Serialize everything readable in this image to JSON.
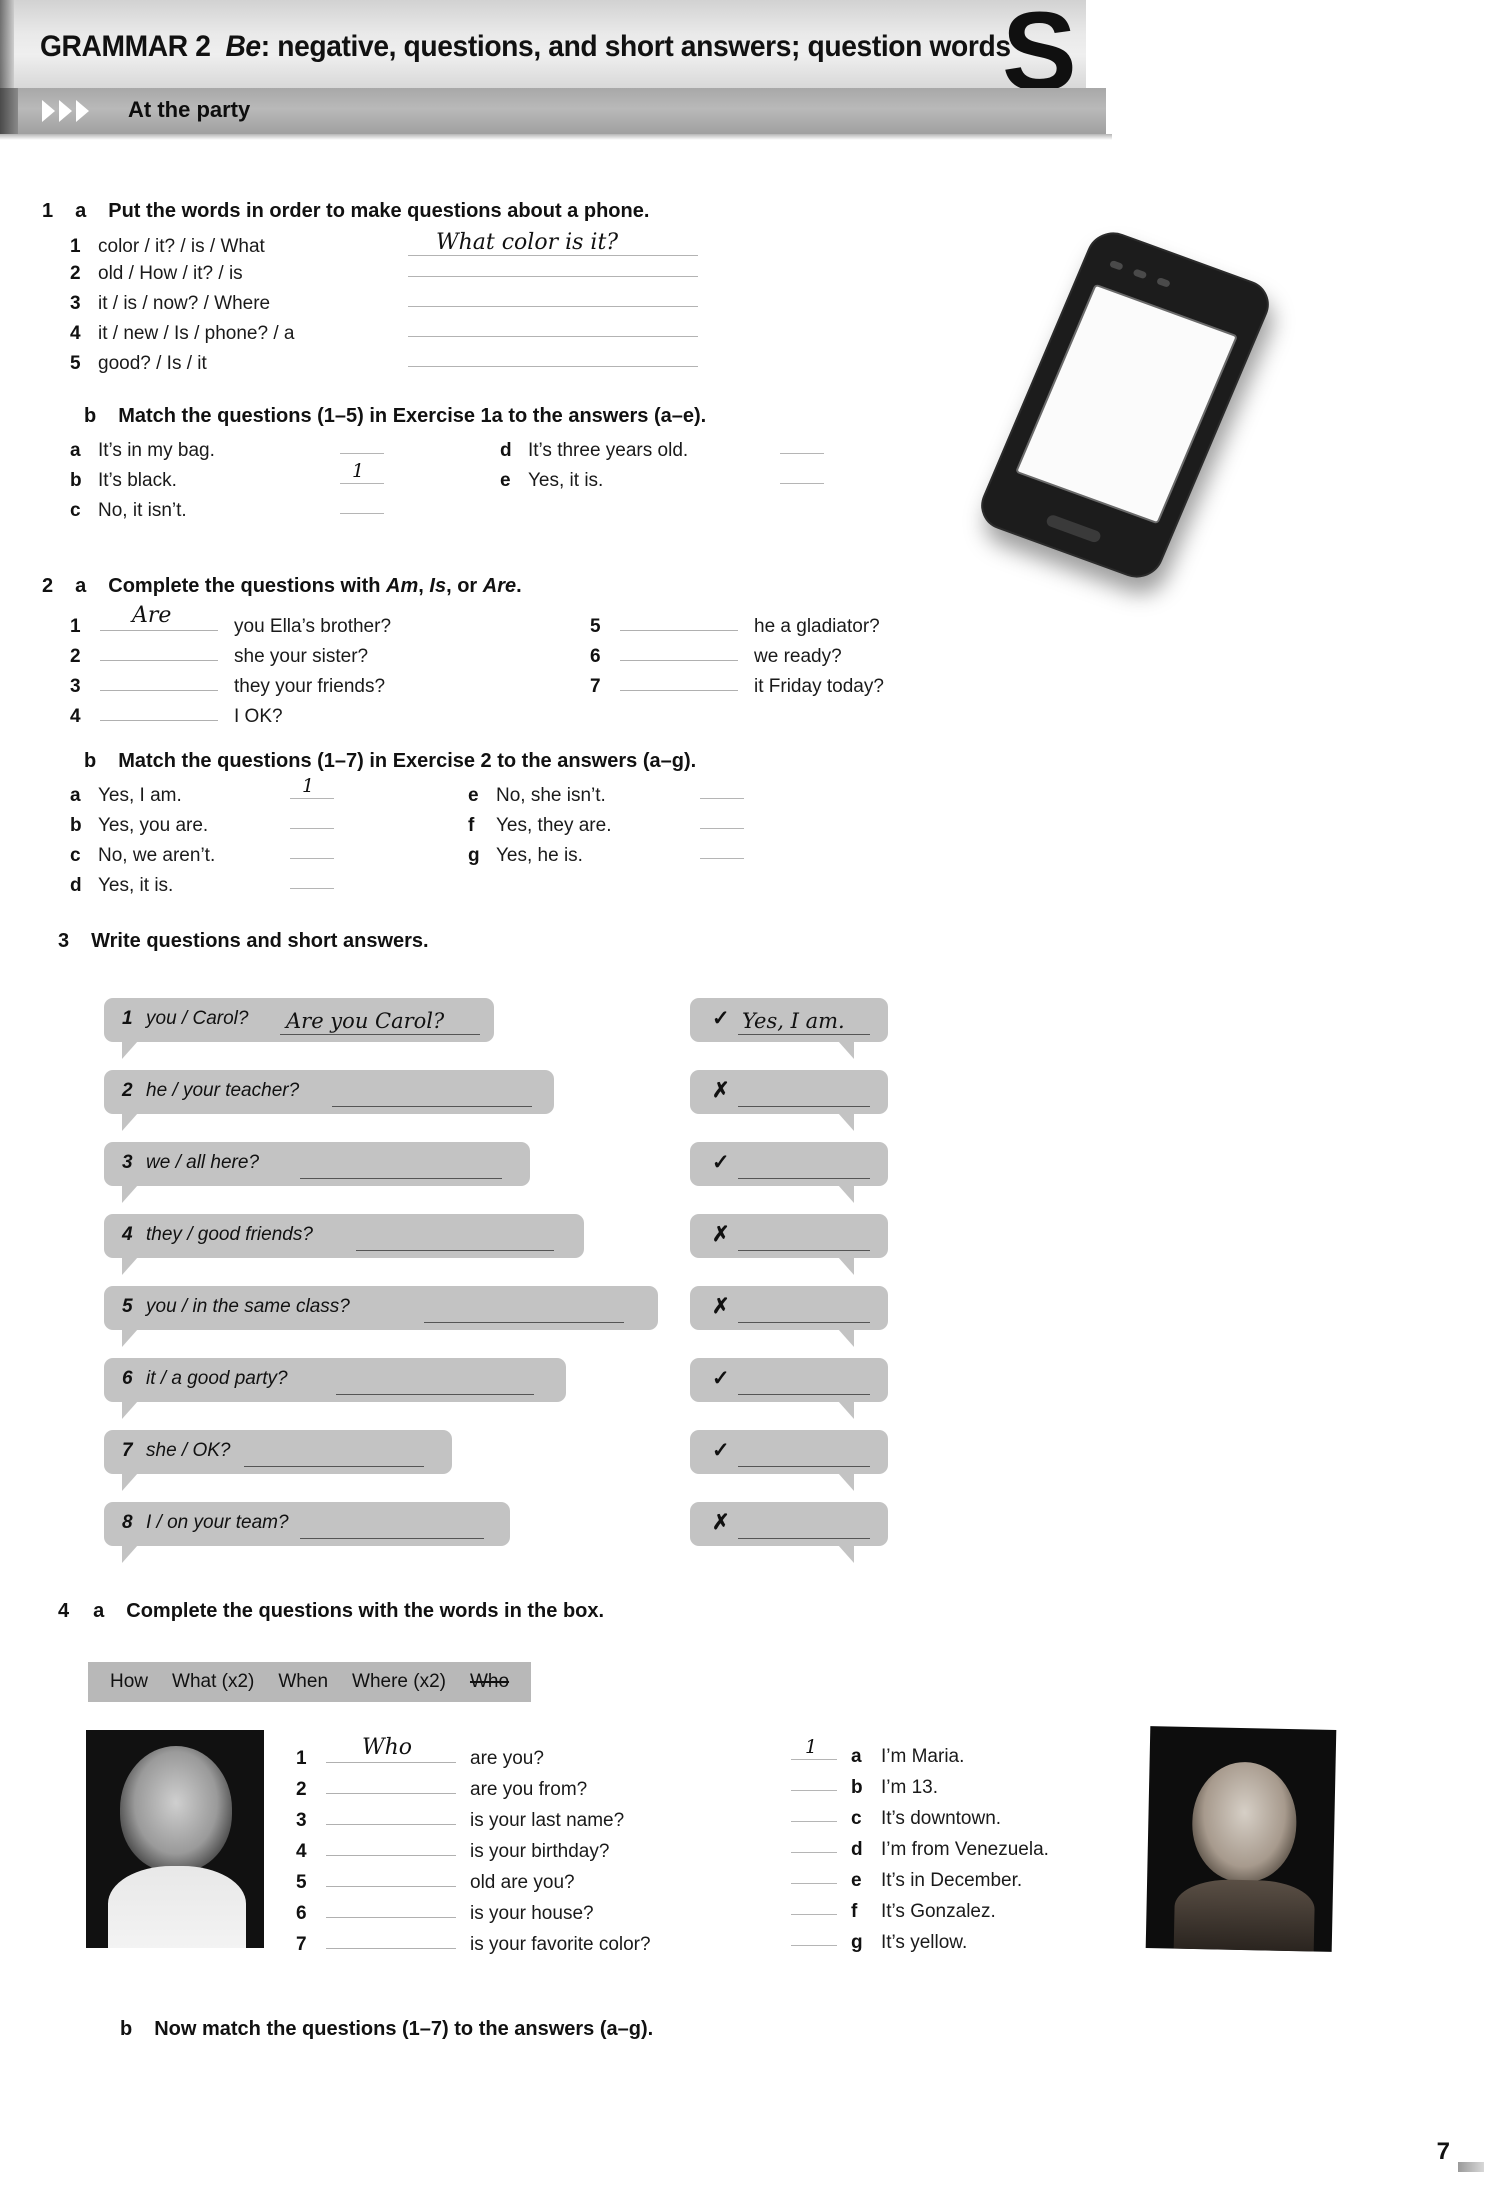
{
  "header": {
    "unit_label": "GRAMMAR 2",
    "title_italic": "Be",
    "title_rest": ": negative, questions, and short answers; question words",
    "corner_letter": "S",
    "section_banner": "At the party",
    "chevron_icon": "chevron-right-icon"
  },
  "ex1": {
    "number": "1",
    "letter": "a",
    "title": "Put the words in order to make questions about a phone.",
    "items": [
      {
        "num": "1",
        "words": "color / it? / is / What",
        "answer": "What color is it?"
      },
      {
        "num": "2",
        "words": "old / How / it? / is",
        "answer": ""
      },
      {
        "num": "3",
        "words": "it / is / now? / Where",
        "answer": ""
      },
      {
        "num": "4",
        "words": "it / new / Is / phone? / a",
        "answer": ""
      },
      {
        "num": "5",
        "words": "good? / Is / it",
        "answer": ""
      }
    ],
    "sub_letter": "b",
    "sub_title": "Match the questions (1–5) in Exercise 1a to the answers (a–e).",
    "match_left": [
      {
        "ltr": "a",
        "txt": "It’s in my bag.",
        "val": ""
      },
      {
        "ltr": "b",
        "txt": "It’s black.",
        "val": "1"
      },
      {
        "ltr": "c",
        "txt": "No, it isn’t.",
        "val": ""
      }
    ],
    "match_right": [
      {
        "ltr": "d",
        "txt": "It’s three years old.",
        "val": ""
      },
      {
        "ltr": "e",
        "txt": "Yes, it is.",
        "val": ""
      }
    ]
  },
  "ex2": {
    "number": "2",
    "letter": "a",
    "title_parts": {
      "pre": "Complete the questions with ",
      "w1": "Am",
      "sep1": ", ",
      "w2": "Is",
      "sep2": ", or ",
      "w3": "Are",
      "post": "."
    },
    "items_left": [
      {
        "num": "1",
        "val": "Are",
        "tail": "you Ella’s brother?"
      },
      {
        "num": "2",
        "val": "",
        "tail": "she your sister?"
      },
      {
        "num": "3",
        "val": "",
        "tail": "they your friends?"
      },
      {
        "num": "4",
        "val": "",
        "tail": "I OK?"
      }
    ],
    "items_right": [
      {
        "num": "5",
        "val": "",
        "tail": "he a gladiator?"
      },
      {
        "num": "6",
        "val": "",
        "tail": "we ready?"
      },
      {
        "num": "7",
        "val": "",
        "tail": "it Friday today?"
      }
    ],
    "sub_letter": "b",
    "sub_title": "Match the questions (1–7) in Exercise 2 to the answers (a–g).",
    "match_left": [
      {
        "ltr": "a",
        "txt": "Yes, I am.",
        "val": "1"
      },
      {
        "ltr": "b",
        "txt": "Yes, you are.",
        "val": ""
      },
      {
        "ltr": "c",
        "txt": "No, we aren’t.",
        "val": ""
      },
      {
        "ltr": "d",
        "txt": "Yes, it is.",
        "val": ""
      }
    ],
    "match_right": [
      {
        "ltr": "e",
        "txt": "No, she isn’t.",
        "val": ""
      },
      {
        "ltr": "f",
        "txt": "Yes, they are.",
        "val": ""
      },
      {
        "ltr": "g",
        "txt": "Yes, he is.",
        "val": ""
      }
    ]
  },
  "ex3": {
    "number": "3",
    "title": "Write questions and short answers.",
    "questions": [
      {
        "num": "1",
        "prompt": "you / Carol?",
        "answer": "Are you Carol?"
      },
      {
        "num": "2",
        "prompt": "he / your teacher?",
        "answer": ""
      },
      {
        "num": "3",
        "prompt": "we / all here?",
        "answer": ""
      },
      {
        "num": "4",
        "prompt": "they / good friends?",
        "answer": ""
      },
      {
        "num": "5",
        "prompt": "you / in the same class?",
        "answer": ""
      },
      {
        "num": "6",
        "prompt": "it / a good party?",
        "answer": ""
      },
      {
        "num": "7",
        "prompt": "she / OK?",
        "answer": ""
      },
      {
        "num": "8",
        "prompt": "I / on your team?",
        "answer": ""
      }
    ],
    "answers": [
      {
        "mark": "✓",
        "answer": "Yes, I am."
      },
      {
        "mark": "✗",
        "answer": ""
      },
      {
        "mark": "✓",
        "answer": ""
      },
      {
        "mark": "✗",
        "answer": ""
      },
      {
        "mark": "✗",
        "answer": ""
      },
      {
        "mark": "✓",
        "answer": ""
      },
      {
        "mark": "✓",
        "answer": ""
      },
      {
        "mark": "✗",
        "answer": ""
      }
    ]
  },
  "ex4": {
    "number": "4",
    "letter": "a",
    "title": "Complete the questions with the words in the box.",
    "wordbox": [
      {
        "word": "How",
        "struck": false
      },
      {
        "word": "What (x2)",
        "struck": false
      },
      {
        "word": "When",
        "struck": false
      },
      {
        "word": "Where (x2)",
        "struck": false
      },
      {
        "word": "Who",
        "struck": true
      }
    ],
    "questions": [
      {
        "num": "1",
        "val": "Who",
        "tail": "are you?"
      },
      {
        "num": "2",
        "val": "",
        "tail": "are you from?"
      },
      {
        "num": "3",
        "val": "",
        "tail": "is your last name?"
      },
      {
        "num": "4",
        "val": "",
        "tail": "is your birthday?"
      },
      {
        "num": "5",
        "val": "",
        "tail": "old are you?"
      },
      {
        "num": "6",
        "val": "",
        "tail": "is your house?"
      },
      {
        "num": "7",
        "val": "",
        "tail": "is your favorite color?"
      }
    ],
    "answers": [
      {
        "val": "1",
        "ltr": "a",
        "txt": "I’m Maria."
      },
      {
        "val": "",
        "ltr": "b",
        "txt": "I’m 13."
      },
      {
        "val": "",
        "ltr": "c",
        "txt": "It’s downtown."
      },
      {
        "val": "",
        "ltr": "d",
        "txt": "I’m from Venezuela."
      },
      {
        "val": "",
        "ltr": "e",
        "txt": "It’s in December."
      },
      {
        "val": "",
        "ltr": "f",
        "txt": "It’s Gonzalez."
      },
      {
        "val": "",
        "ltr": "g",
        "txt": "It’s yellow."
      }
    ],
    "sub_letter": "b",
    "sub_title": "Now match the questions (1–7) to the answers (a–g)."
  },
  "footer": {
    "page_number": "7"
  },
  "colors": {
    "bubble_gray": "#c3c3c3",
    "wordbox_gray": "#b8b8b8",
    "band_gray": "#b0b0b0",
    "ink": "#111111"
  }
}
